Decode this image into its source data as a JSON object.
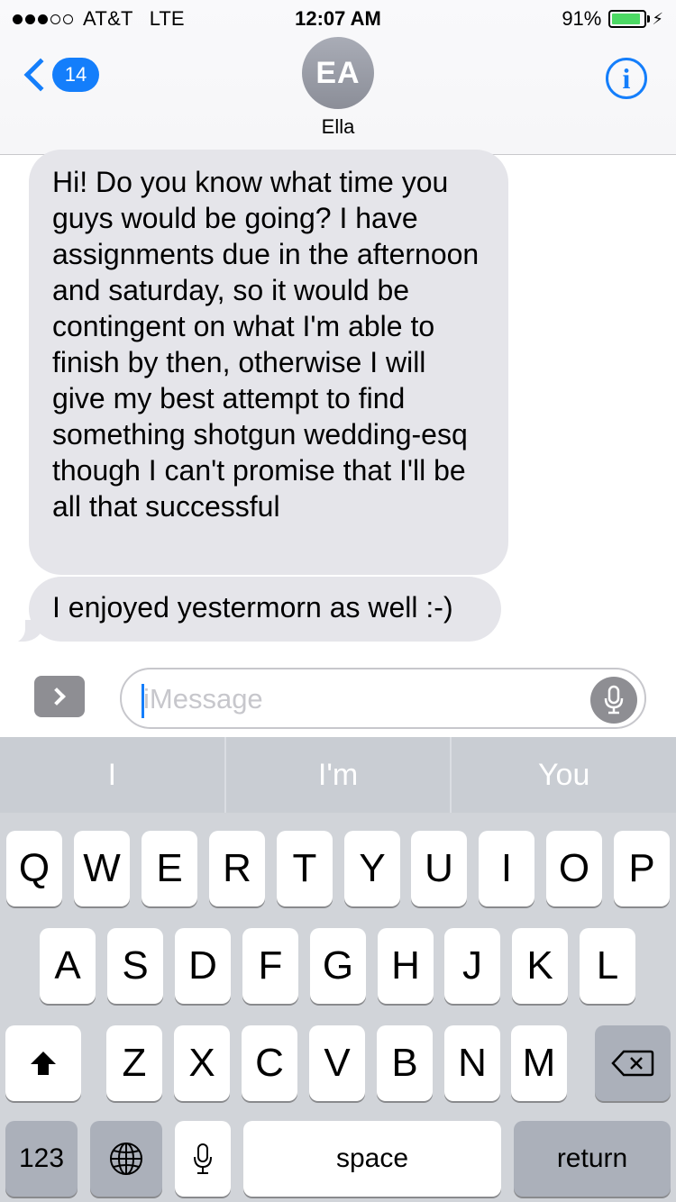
{
  "status_bar": {
    "carrier": "AT&T",
    "network": "LTE",
    "time": "12:07 AM",
    "battery_percent": "91%",
    "signal_bars_filled": 3,
    "signal_bars_total": 5,
    "battery_level": 0.91
  },
  "header": {
    "back_count": "14",
    "avatar_initials": "EA",
    "contact_name": "Ella",
    "info_icon_glyph": "i"
  },
  "messages": [
    {
      "direction": "incoming",
      "text": "Hi! Do you know what time you guys would be going? I have assignments due in the afternoon and saturday, so it would be contingent on what I'm able to finish by then, otherwise I will give my best attempt to find something shotgun wedding-esq though I can't promise that I'll be all that successful"
    },
    {
      "direction": "incoming",
      "text": "I enjoyed yestermorn as well :-)"
    }
  ],
  "compose": {
    "placeholder": "iMessage"
  },
  "keyboard": {
    "suggestions": [
      "I",
      "I'm",
      "You"
    ],
    "row1": [
      "Q",
      "W",
      "E",
      "R",
      "T",
      "Y",
      "U",
      "I",
      "O",
      "P"
    ],
    "row2": [
      "A",
      "S",
      "D",
      "F",
      "G",
      "H",
      "J",
      "K",
      "L"
    ],
    "row3": [
      "Z",
      "X",
      "C",
      "V",
      "B",
      "N",
      "M"
    ],
    "numbers_label": "123",
    "space_label": "space",
    "return_label": "return"
  },
  "colors": {
    "accent": "#147efb",
    "incoming_bubble": "#e5e5ea",
    "keyboard_bg": "#d1d4d9",
    "battery": "#4cd964"
  }
}
